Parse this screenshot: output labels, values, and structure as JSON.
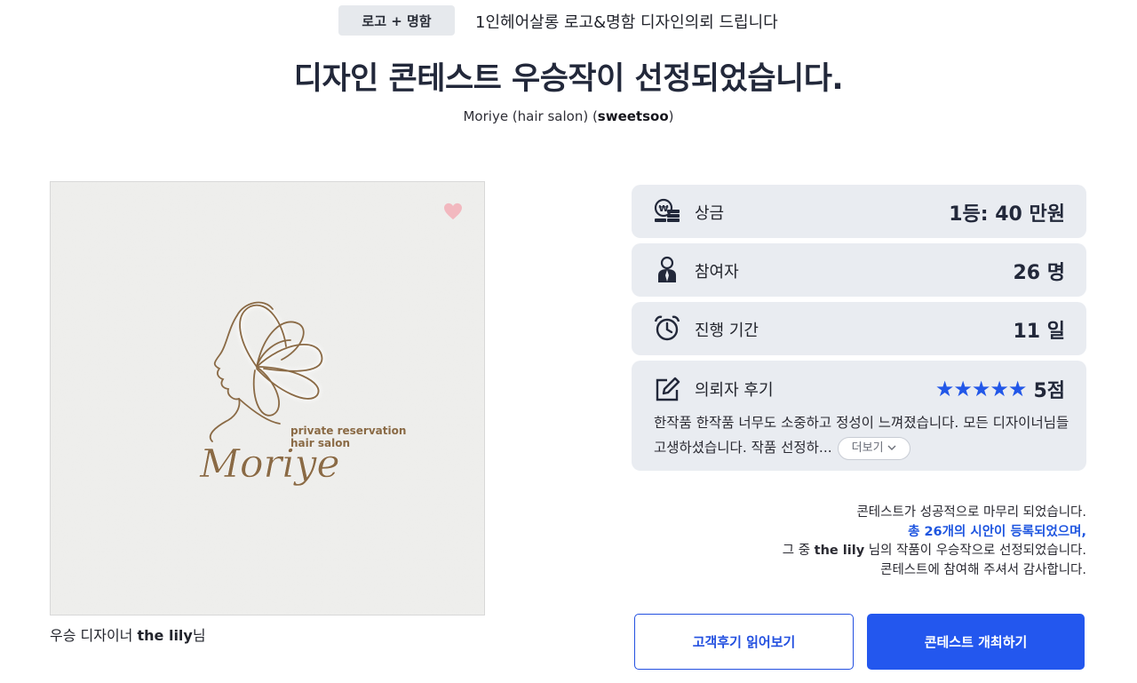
{
  "header": {
    "category_badge": "로고 + 명함",
    "request_title": "1인헤어살롱 로고&명함 디자인의뢰 드립니다",
    "headline": "디자인 콘테스트 우승작이 선정되었습니다.",
    "subtitle_prefix": "Moriye (hair salon) (",
    "subtitle_user": "sweetsoo",
    "subtitle_suffix": ")"
  },
  "artwork": {
    "brand_script": "Moriye",
    "line1": "private reservation",
    "line2": "hair salon",
    "ink_color": "#8a6a45",
    "heart_color": "#f2b8bf"
  },
  "winner": {
    "prefix": "우승 디자이너 ",
    "name": "the lily",
    "suffix": "님"
  },
  "stats": {
    "prize": {
      "icon": "money-icon",
      "label": "상금",
      "value": "1등: 40 만원"
    },
    "participants": {
      "icon": "person-icon",
      "label": "참여자",
      "value": "26 명"
    },
    "period": {
      "icon": "alarm-clock-icon",
      "label": "진행 기간",
      "value": "11 일"
    },
    "review": {
      "icon": "edit-icon",
      "label": "의뢰자 후기",
      "stars": "★★★★★",
      "rating": 5,
      "rating_text": "5점",
      "text": "한작품 한작품 너무도 소중하고 정성이 느껴졌습니다. 모든 디자이너님들 고생하셨습니다. 작품 선정하...",
      "more_label": "더보기"
    }
  },
  "summary": {
    "line1": "콘테스트가 성공적으로 마무리 되었습니다.",
    "line2": "총 26개의 시안이 등록되었으며,",
    "line3_prefix": "그 중 ",
    "line3_name": "the lily",
    "line3_suffix": " 님의 작품이 우승작으로 선정되었습니다.",
    "line4": "콘테스트에 참여해 주셔서 감사합니다."
  },
  "buttons": {
    "reviews": "고객후기 읽어보기",
    "host": "콘테스트 개최하기"
  },
  "colors": {
    "accent": "#2357ee",
    "card_bg": "#e9ecf1",
    "star": "#2257e8"
  }
}
